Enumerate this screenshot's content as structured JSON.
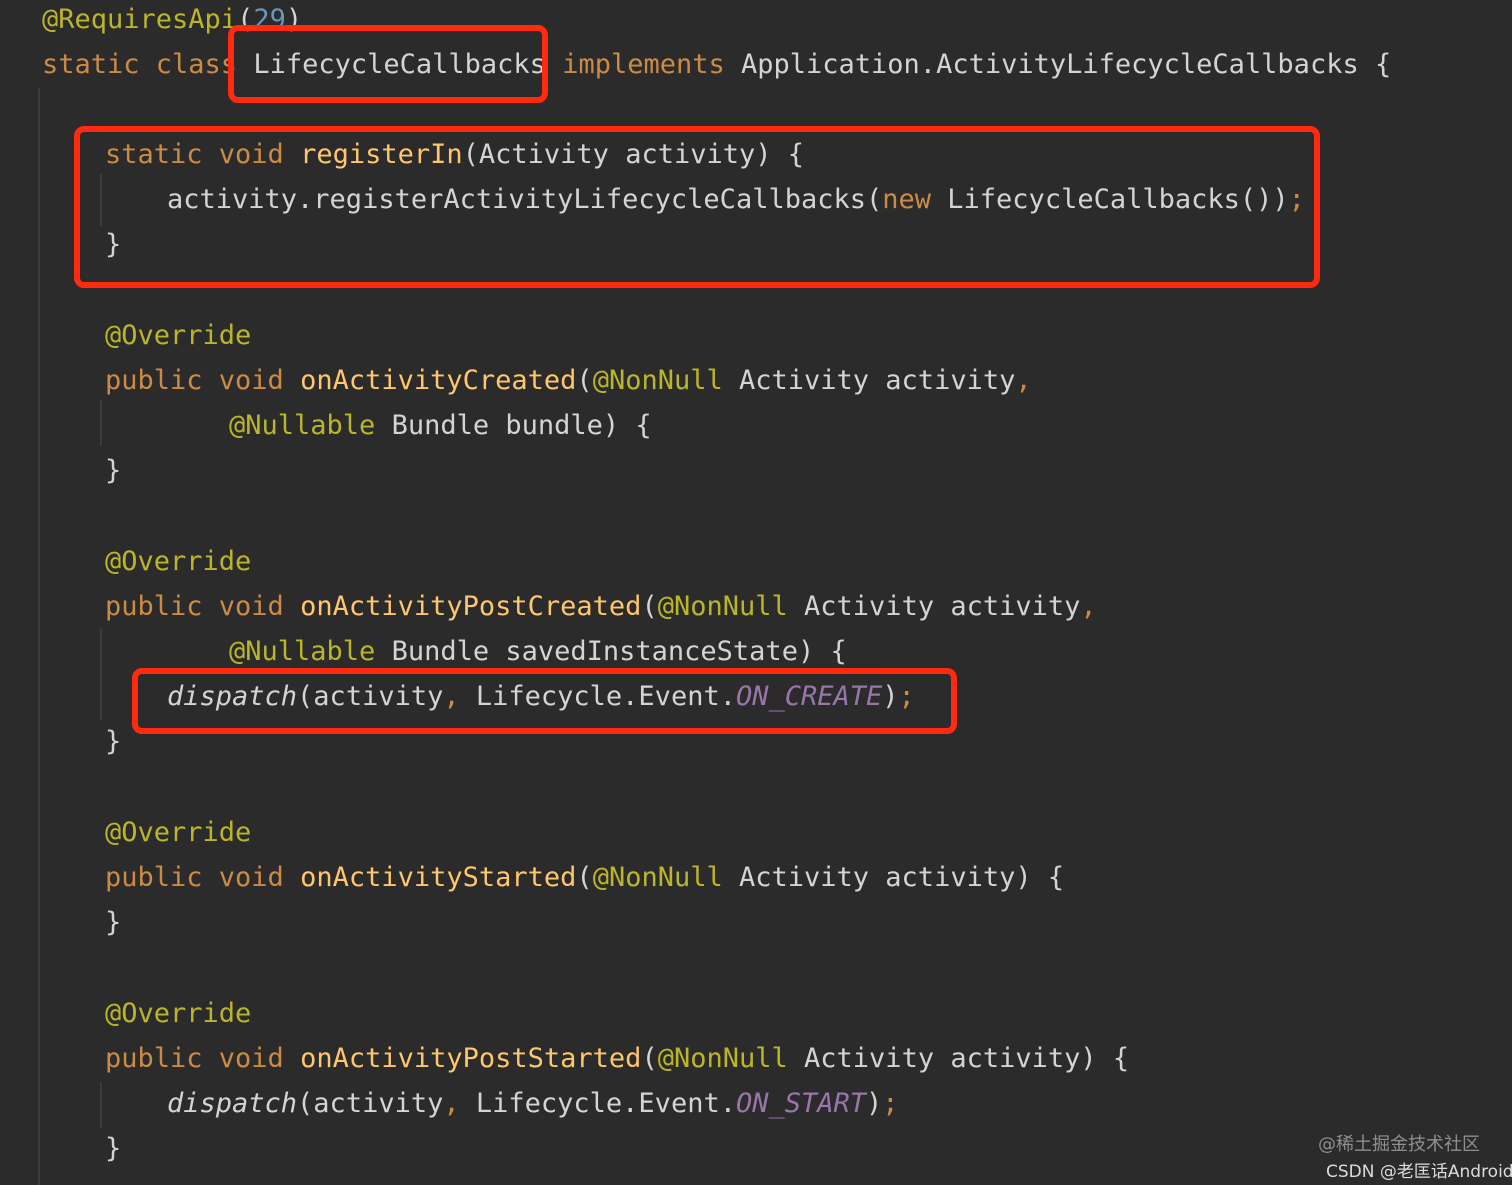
{
  "theme": {
    "background": "#2b2b2b",
    "indent_guide": "#3b3b3b",
    "highlight_box": "#ff2a10"
  },
  "colors": {
    "plain": "#d4d4d4",
    "keyword": "#cc8b45",
    "annotation": "#bbb529",
    "method": "#ffc66d",
    "number": "#6897bb",
    "constant": "#9876aa",
    "watermark": "#8f8f8f",
    "watermark_bright": "#dcdcdc"
  },
  "code": {
    "lines": [
      [
        [
          "annotation",
          "@RequiresApi"
        ],
        [
          "plain",
          "("
        ],
        [
          "number",
          "29"
        ],
        [
          "plain",
          ")"
        ]
      ],
      [
        [
          "keyword",
          "static class "
        ],
        [
          "plain",
          "LifecycleCallbacks "
        ],
        [
          "keyword",
          "implements "
        ],
        [
          "plain",
          "Application.ActivityLifecycleCallbacks {"
        ]
      ],
      [],
      [
        [
          "keyword",
          "static void "
        ],
        [
          "method",
          "registerIn"
        ],
        [
          "plain",
          "(Activity activity) {"
        ]
      ],
      [
        [
          "plain",
          "activity.registerActivityLifecycleCallbacks("
        ],
        [
          "keyword",
          "new "
        ],
        [
          "plain",
          "LifecycleCallbacks())"
        ],
        [
          "keyword",
          ";"
        ]
      ],
      [
        [
          "plain",
          "}"
        ]
      ],
      [],
      [
        [
          "annotation",
          "@Override"
        ]
      ],
      [
        [
          "keyword",
          "public void "
        ],
        [
          "method",
          "onActivityCreated"
        ],
        [
          "plain",
          "("
        ],
        [
          "annotation",
          "@NonNull "
        ],
        [
          "plain",
          "Activity activity"
        ],
        [
          "keyword",
          ","
        ]
      ],
      [
        [
          "annotation",
          "@Nullable "
        ],
        [
          "plain",
          "Bundle bundle) {"
        ]
      ],
      [
        [
          "plain",
          "}"
        ]
      ],
      [],
      [
        [
          "annotation",
          "@Override"
        ]
      ],
      [
        [
          "keyword",
          "public void "
        ],
        [
          "method",
          "onActivityPostCreated"
        ],
        [
          "plain",
          "("
        ],
        [
          "annotation",
          "@NonNull "
        ],
        [
          "plain",
          "Activity activity"
        ],
        [
          "keyword",
          ","
        ]
      ],
      [
        [
          "annotation",
          "@Nullable "
        ],
        [
          "plain",
          "Bundle savedInstanceState) {"
        ]
      ],
      [
        [
          "italic",
          "dispatch"
        ],
        [
          "plain",
          "(activity"
        ],
        [
          "keyword",
          ", "
        ],
        [
          "plain",
          "Lifecycle.Event."
        ],
        [
          "constant",
          "ON_CREATE"
        ],
        [
          "plain",
          ")"
        ],
        [
          "keyword",
          ";"
        ]
      ],
      [
        [
          "plain",
          "}"
        ]
      ],
      [],
      [
        [
          "annotation",
          "@Override"
        ]
      ],
      [
        [
          "keyword",
          "public void "
        ],
        [
          "method",
          "onActivityStarted"
        ],
        [
          "plain",
          "("
        ],
        [
          "annotation",
          "@NonNull "
        ],
        [
          "plain",
          "Activity activity) {"
        ]
      ],
      [
        [
          "plain",
          "}"
        ]
      ],
      [],
      [
        [
          "annotation",
          "@Override"
        ]
      ],
      [
        [
          "keyword",
          "public void "
        ],
        [
          "method",
          "onActivityPostStarted"
        ],
        [
          "plain",
          "("
        ],
        [
          "annotation",
          "@NonNull "
        ],
        [
          "plain",
          "Activity activity) {"
        ]
      ],
      [
        [
          "italic",
          "dispatch"
        ],
        [
          "plain",
          "(activity"
        ],
        [
          "keyword",
          ", "
        ],
        [
          "plain",
          "Lifecycle.Event."
        ],
        [
          "constant",
          "ON_START"
        ],
        [
          "plain",
          ")"
        ],
        [
          "keyword",
          ";"
        ]
      ],
      [
        [
          "plain",
          "}"
        ]
      ]
    ]
  },
  "watermark": {
    "line1": "@稀土掘金技术社区",
    "line2": "CSDN @老匡话Android"
  }
}
